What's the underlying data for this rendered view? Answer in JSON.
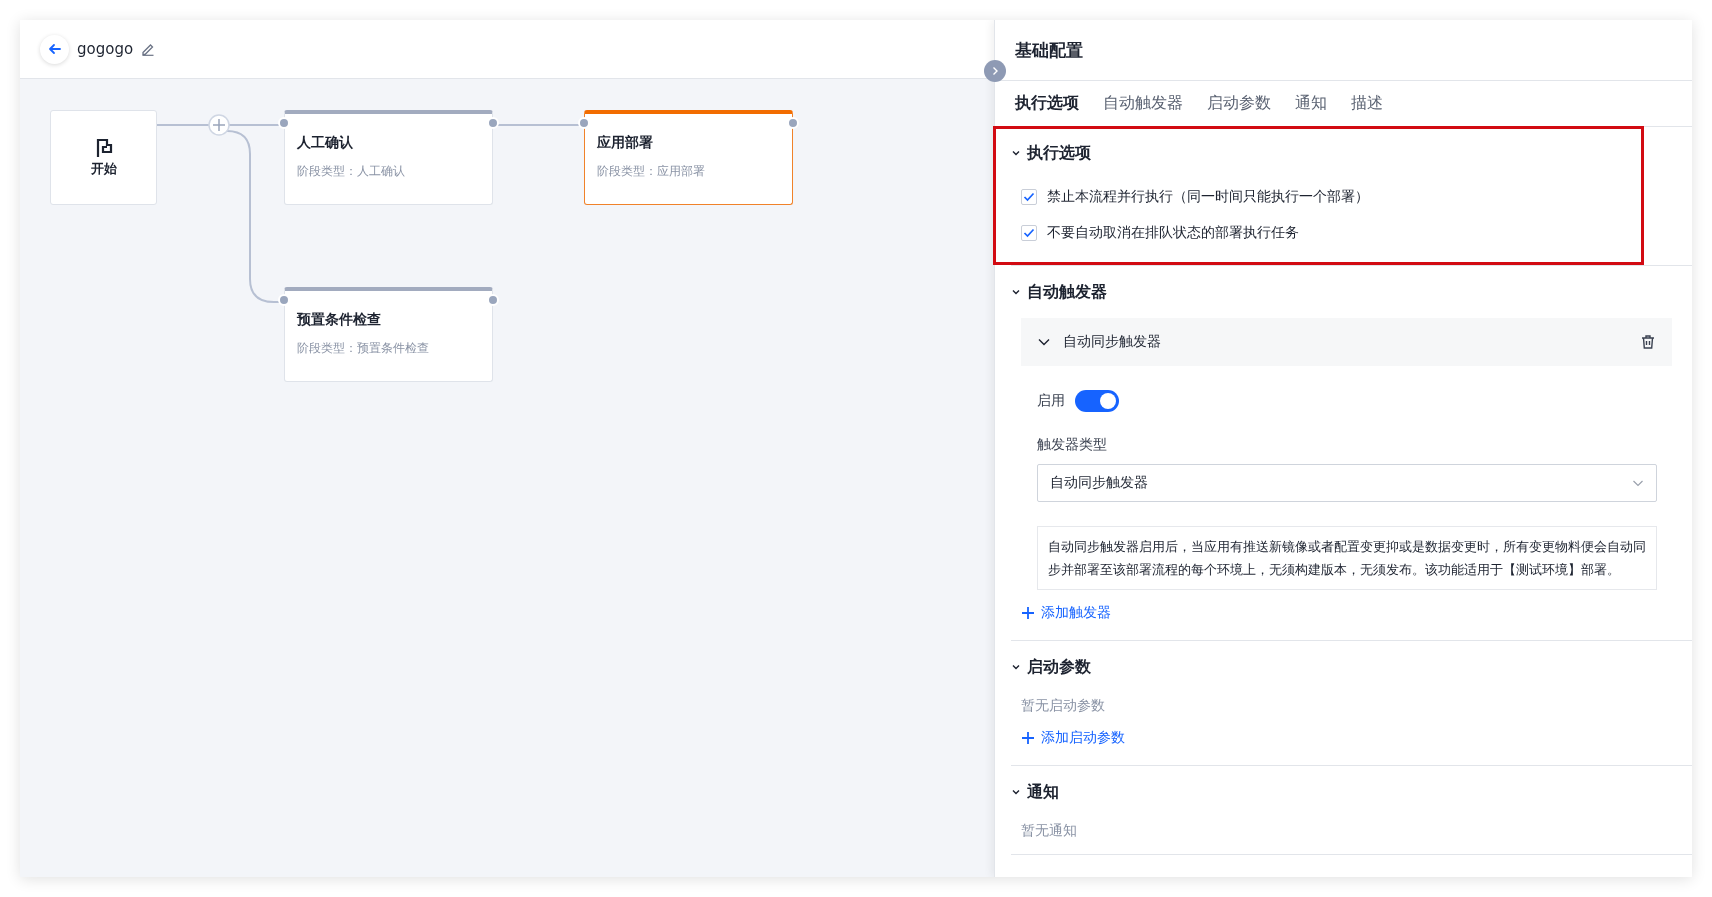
{
  "header": {
    "title": "gogogo"
  },
  "canvas": {
    "start": {
      "label": "开始"
    },
    "stages": [
      {
        "title": "人工确认",
        "subtitle": "阶段类型：人工确认",
        "selected": false
      },
      {
        "title": "应用部署",
        "subtitle": "阶段类型：应用部署",
        "selected": true
      },
      {
        "title": "预置条件检查",
        "subtitle": "阶段类型：预置条件检查",
        "selected": false
      }
    ]
  },
  "panel": {
    "title": "基础配置",
    "tabs": [
      {
        "label": "执行选项",
        "selected": true
      },
      {
        "label": "自动触发器",
        "selected": false
      },
      {
        "label": "启动参数",
        "selected": false
      },
      {
        "label": "通知",
        "selected": false
      },
      {
        "label": "描述",
        "selected": false
      }
    ],
    "sections": [
      {
        "kind": "options",
        "title": "执行选项",
        "expanded": true,
        "highlighted": true,
        "options": [
          {
            "label": "禁止本流程并行执行（同一时间只能执行一个部署）",
            "checked": true
          },
          {
            "label": "不要自动取消在排队状态的部署执行任务",
            "checked": true
          }
        ]
      },
      {
        "kind": "triggers",
        "title": "自动触发器",
        "expanded": true,
        "highlighted": false,
        "triggers": [
          {
            "name": "自动同步触发器",
            "expanded": true,
            "enable_label": "启用",
            "enabled": true,
            "type_label": "触发器类型",
            "type_value": "自动同步触发器",
            "description": "自动同步触发器启用后，当应用有推送新镜像或者配置变更抑或是数据变更时，所有变更物料便会自动同步并部署至该部署流程的每个环境上，无须构建版本，无须发布。该功能适用于【测试环境】部署。"
          }
        ],
        "add_label": "添加触发器"
      },
      {
        "kind": "params",
        "title": "启动参数",
        "expanded": true,
        "highlighted": false,
        "empty_text": "暂无启动参数",
        "add_label": "添加启动参数"
      },
      {
        "kind": "notify",
        "title": "通知",
        "expanded": true,
        "highlighted": false,
        "empty_text": "暂无通知"
      }
    ]
  }
}
